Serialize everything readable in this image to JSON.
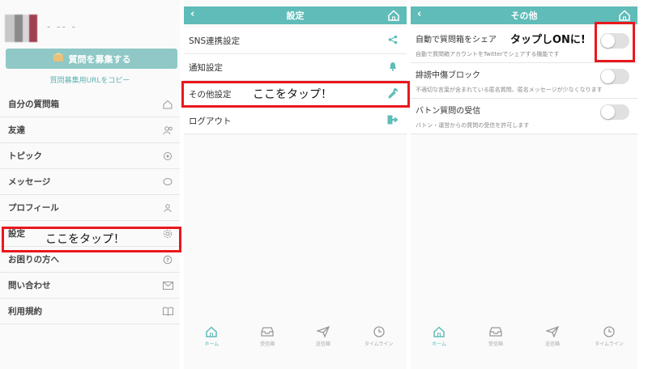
{
  "panel1": {
    "username": "- -- -",
    "recruit_label": "質問を募集する",
    "copy_label": "質問募集用URLをコピー",
    "menu": [
      {
        "label": "自分の質問箱",
        "icon": "home-icon"
      },
      {
        "label": "友達",
        "icon": "users-icon"
      },
      {
        "label": "トピック",
        "icon": "topic-icon"
      },
      {
        "label": "メッセージ",
        "icon": "chat-icon"
      },
      {
        "label": "プロフィール",
        "icon": "user-icon"
      },
      {
        "label": "設定",
        "icon": "gear-icon"
      },
      {
        "label": "お困りの方へ",
        "icon": "help-icon"
      },
      {
        "label": "問い合わせ",
        "icon": "mail-icon"
      },
      {
        "label": "利用規約",
        "icon": "book-icon"
      }
    ]
  },
  "panel2": {
    "title": "設定",
    "items": [
      {
        "label": "SNS連携設定",
        "icon": "share-icon"
      },
      {
        "label": "通知設定",
        "icon": "bell-icon"
      },
      {
        "label": "その他設定",
        "icon": "wrench-icon"
      },
      {
        "label": "ログアウト",
        "icon": "logout-icon"
      }
    ]
  },
  "panel3": {
    "title": "その他",
    "items": [
      {
        "title": "自動で質問箱をシェア",
        "desc": "自動で質問箱アカウントをTwitterでシェアする機能です",
        "enabled": false
      },
      {
        "title": "誹謗中傷ブロック",
        "desc": "不適切な言葉が含まれている匿名質問、匿名メッセージが少なくなります",
        "enabled": false
      },
      {
        "title": "バトン質問の受信",
        "desc": "バトン・運営からの質問の受信を許可します",
        "enabled": false
      }
    ]
  },
  "tabs": [
    "ホーム",
    "受信箱",
    "送信箱",
    "タイムライン"
  ],
  "annotations": {
    "tap_here_1": "ここをタップ！",
    "tap_here_2": "ここをタップ！",
    "tap_on": "タップしONに!"
  },
  "colors": {
    "accent": "#5fbcb8",
    "button": "#8fc8c6",
    "highlight": "#e8181e"
  }
}
